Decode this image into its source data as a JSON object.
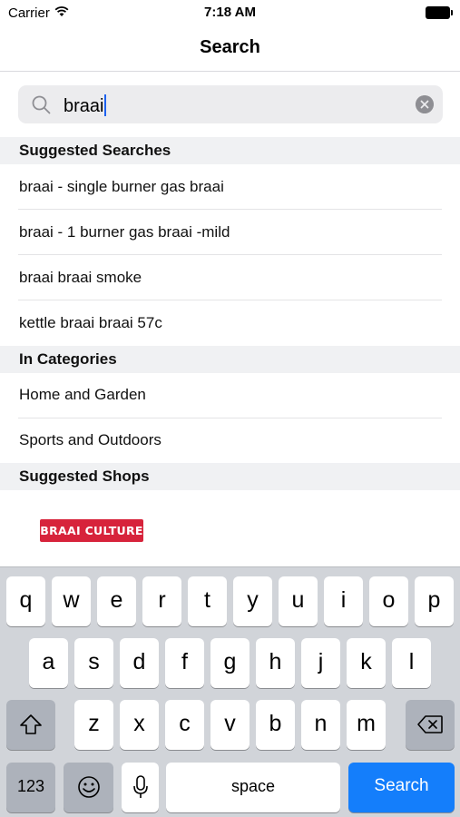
{
  "status_bar": {
    "carrier": "Carrier",
    "time": "7:18 AM"
  },
  "nav": {
    "title": "Search"
  },
  "search": {
    "value": "braai",
    "icon": "search-icon",
    "clear_icon": "clear-icon"
  },
  "sections": {
    "suggested_searches": {
      "header": "Suggested Searches",
      "items": [
        "braai - single burner gas braai",
        "braai - 1 burner gas braai -mild",
        "braai braai smoke",
        "kettle braai braai 57c"
      ]
    },
    "categories": {
      "header": "In Categories",
      "items": [
        "Home and Garden",
        "Sports and Outdoors"
      ]
    },
    "shops": {
      "header": "Suggested Shops",
      "logo_text": "BRAAI CULTURE"
    }
  },
  "keyboard": {
    "row1": [
      "q",
      "w",
      "e",
      "r",
      "t",
      "y",
      "u",
      "i",
      "o",
      "p"
    ],
    "row2": [
      "a",
      "s",
      "d",
      "f",
      "g",
      "h",
      "j",
      "k",
      "l"
    ],
    "row3": [
      "z",
      "x",
      "c",
      "v",
      "b",
      "n",
      "m"
    ],
    "numbers_label": "123",
    "space_label": "space",
    "search_label": "Search",
    "icons": {
      "shift": "shift-icon",
      "delete": "delete-icon",
      "emoji": "emoji-icon",
      "mic": "microphone-icon"
    }
  },
  "colors": {
    "accent": "#147efb",
    "caret": "#1d62f0",
    "logo": "#d7233b",
    "section_bg": "#f0f1f3"
  }
}
